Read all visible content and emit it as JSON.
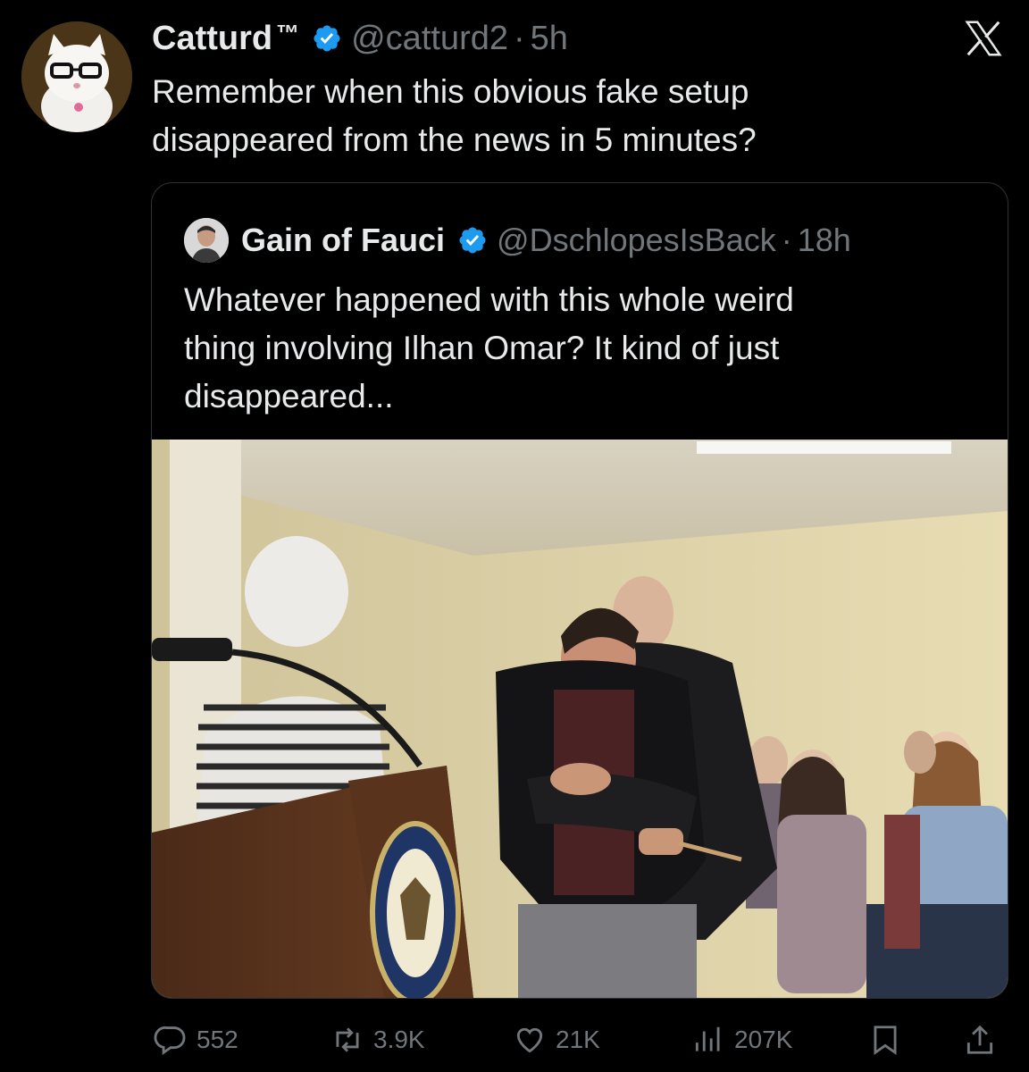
{
  "tweet": {
    "author_name": "Catturd",
    "author_suffix": "™",
    "handle": "@catturd2",
    "separator": "·",
    "time": "5h",
    "text_line1": "Remember when this obvious fake setup",
    "text_line2": "disappeared from the news in 5 minutes?"
  },
  "quote": {
    "author_name": "Gain of Fauci",
    "handle": "@DschlopesIsBack",
    "separator": "·",
    "time": "18h",
    "text_line1": "Whatever happened with this whole weird",
    "text_line2": "thing involving Ilhan Omar?  It kind of just",
    "text_line3": "disappeared..."
  },
  "actions": {
    "replies": "552",
    "reposts": "3.9K",
    "likes": "21K",
    "views": "207K"
  },
  "icons": {
    "reply": "reply-icon",
    "repost": "repost-icon",
    "like": "heart-icon",
    "views": "views-icon",
    "bookmark": "bookmark-icon",
    "share": "share-icon",
    "brand": "x-logo-icon",
    "verified": "verified-badge-icon"
  },
  "colors": {
    "background": "#000000",
    "text": "#e7e9ea",
    "muted": "#71767b",
    "verified": "#1d9bf0",
    "border": "#2f3336"
  }
}
